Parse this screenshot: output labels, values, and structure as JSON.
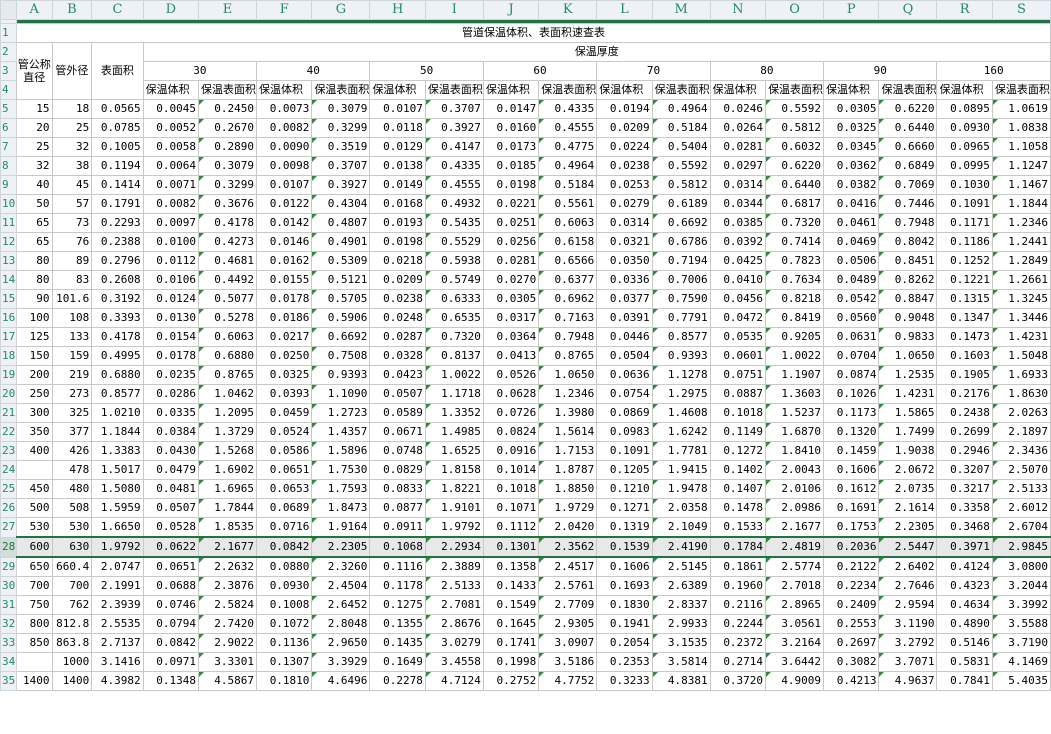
{
  "columns": [
    "A",
    "B",
    "C",
    "D",
    "E",
    "F",
    "G",
    "H",
    "I",
    "J",
    "K",
    "L",
    "M",
    "N",
    "O",
    "P",
    "Q",
    "R",
    "S"
  ],
  "title": "管道保温体积、表面积速查表",
  "headers": {
    "nominal": "管公称直径",
    "outer": "管外径",
    "surface": "表面积",
    "thickness": "保温厚度",
    "thickness_values": [
      "30",
      "40",
      "50",
      "60",
      "70",
      "80",
      "90",
      "160"
    ],
    "vol": "保温体积",
    "surf": "保温表面积"
  },
  "row_numbers": [
    "4",
    "5",
    "6",
    "7",
    "8",
    "9",
    "10",
    "11",
    "12",
    "13",
    "14",
    "15",
    "16",
    "17",
    "18",
    "19",
    "20",
    "21",
    "22",
    "23",
    "24",
    "25",
    "26",
    "27",
    "28",
    "29",
    "30",
    "31",
    "32",
    "33",
    "34",
    "35"
  ],
  "rows": [
    [
      "15",
      "18",
      "0.0565",
      "0.0045",
      "0.2450",
      "0.0073",
      "0.3079",
      "0.0107",
      "0.3707",
      "0.0147",
      "0.4335",
      "0.0194",
      "0.4964",
      "0.0246",
      "0.5592",
      "0.0305",
      "0.6220",
      "0.0895",
      "1.0619"
    ],
    [
      "20",
      "25",
      "0.0785",
      "0.0052",
      "0.2670",
      "0.0082",
      "0.3299",
      "0.0118",
      "0.3927",
      "0.0160",
      "0.4555",
      "0.0209",
      "0.5184",
      "0.0264",
      "0.5812",
      "0.0325",
      "0.6440",
      "0.0930",
      "1.0838"
    ],
    [
      "25",
      "32",
      "0.1005",
      "0.0058",
      "0.2890",
      "0.0090",
      "0.3519",
      "0.0129",
      "0.4147",
      "0.0173",
      "0.4775",
      "0.0224",
      "0.5404",
      "0.0281",
      "0.6032",
      "0.0345",
      "0.6660",
      "0.0965",
      "1.1058"
    ],
    [
      "32",
      "38",
      "0.1194",
      "0.0064",
      "0.3079",
      "0.0098",
      "0.3707",
      "0.0138",
      "0.4335",
      "0.0185",
      "0.4964",
      "0.0238",
      "0.5592",
      "0.0297",
      "0.6220",
      "0.0362",
      "0.6849",
      "0.0995",
      "1.1247"
    ],
    [
      "40",
      "45",
      "0.1414",
      "0.0071",
      "0.3299",
      "0.0107",
      "0.3927",
      "0.0149",
      "0.4555",
      "0.0198",
      "0.5184",
      "0.0253",
      "0.5812",
      "0.0314",
      "0.6440",
      "0.0382",
      "0.7069",
      "0.1030",
      "1.1467"
    ],
    [
      "50",
      "57",
      "0.1791",
      "0.0082",
      "0.3676",
      "0.0122",
      "0.4304",
      "0.0168",
      "0.4932",
      "0.0221",
      "0.5561",
      "0.0279",
      "0.6189",
      "0.0344",
      "0.6817",
      "0.0416",
      "0.7446",
      "0.1091",
      "1.1844"
    ],
    [
      "65",
      "73",
      "0.2293",
      "0.0097",
      "0.4178",
      "0.0142",
      "0.4807",
      "0.0193",
      "0.5435",
      "0.0251",
      "0.6063",
      "0.0314",
      "0.6692",
      "0.0385",
      "0.7320",
      "0.0461",
      "0.7948",
      "0.1171",
      "1.2346"
    ],
    [
      "65",
      "76",
      "0.2388",
      "0.0100",
      "0.4273",
      "0.0146",
      "0.4901",
      "0.0198",
      "0.5529",
      "0.0256",
      "0.6158",
      "0.0321",
      "0.6786",
      "0.0392",
      "0.7414",
      "0.0469",
      "0.8042",
      "0.1186",
      "1.2441"
    ],
    [
      "80",
      "89",
      "0.2796",
      "0.0112",
      "0.4681",
      "0.0162",
      "0.5309",
      "0.0218",
      "0.5938",
      "0.0281",
      "0.6566",
      "0.0350",
      "0.7194",
      "0.0425",
      "0.7823",
      "0.0506",
      "0.8451",
      "0.1252",
      "1.2849"
    ],
    [
      "80",
      "83",
      "0.2608",
      "0.0106",
      "0.4492",
      "0.0155",
      "0.5121",
      "0.0209",
      "0.5749",
      "0.0270",
      "0.6377",
      "0.0336",
      "0.7006",
      "0.0410",
      "0.7634",
      "0.0489",
      "0.8262",
      "0.1221",
      "1.2661"
    ],
    [
      "90",
      "101.6",
      "0.3192",
      "0.0124",
      "0.5077",
      "0.0178",
      "0.5705",
      "0.0238",
      "0.6333",
      "0.0305",
      "0.6962",
      "0.0377",
      "0.7590",
      "0.0456",
      "0.8218",
      "0.0542",
      "0.8847",
      "0.1315",
      "1.3245"
    ],
    [
      "100",
      "108",
      "0.3393",
      "0.0130",
      "0.5278",
      "0.0186",
      "0.5906",
      "0.0248",
      "0.6535",
      "0.0317",
      "0.7163",
      "0.0391",
      "0.7791",
      "0.0472",
      "0.8419",
      "0.0560",
      "0.9048",
      "0.1347",
      "1.3446"
    ],
    [
      "125",
      "133",
      "0.4178",
      "0.0154",
      "0.6063",
      "0.0217",
      "0.6692",
      "0.0287",
      "0.7320",
      "0.0364",
      "0.7948",
      "0.0446",
      "0.8577",
      "0.0535",
      "0.9205",
      "0.0631",
      "0.9833",
      "0.1473",
      "1.4231"
    ],
    [
      "150",
      "159",
      "0.4995",
      "0.0178",
      "0.6880",
      "0.0250",
      "0.7508",
      "0.0328",
      "0.8137",
      "0.0413",
      "0.8765",
      "0.0504",
      "0.9393",
      "0.0601",
      "1.0022",
      "0.0704",
      "1.0650",
      "0.1603",
      "1.5048"
    ],
    [
      "200",
      "219",
      "0.6880",
      "0.0235",
      "0.8765",
      "0.0325",
      "0.9393",
      "0.0423",
      "1.0022",
      "0.0526",
      "1.0650",
      "0.0636",
      "1.1278",
      "0.0751",
      "1.1907",
      "0.0874",
      "1.2535",
      "0.1905",
      "1.6933"
    ],
    [
      "250",
      "273",
      "0.8577",
      "0.0286",
      "1.0462",
      "0.0393",
      "1.1090",
      "0.0507",
      "1.1718",
      "0.0628",
      "1.2346",
      "0.0754",
      "1.2975",
      "0.0887",
      "1.3603",
      "0.1026",
      "1.4231",
      "0.2176",
      "1.8630"
    ],
    [
      "300",
      "325",
      "1.0210",
      "0.0335",
      "1.2095",
      "0.0459",
      "1.2723",
      "0.0589",
      "1.3352",
      "0.0726",
      "1.3980",
      "0.0869",
      "1.4608",
      "0.1018",
      "1.5237",
      "0.1173",
      "1.5865",
      "0.2438",
      "2.0263"
    ],
    [
      "350",
      "377",
      "1.1844",
      "0.0384",
      "1.3729",
      "0.0524",
      "1.4357",
      "0.0671",
      "1.4985",
      "0.0824",
      "1.5614",
      "0.0983",
      "1.6242",
      "0.1149",
      "1.6870",
      "0.1320",
      "1.7499",
      "0.2699",
      "2.1897"
    ],
    [
      "400",
      "426",
      "1.3383",
      "0.0430",
      "1.5268",
      "0.0586",
      "1.5896",
      "0.0748",
      "1.6525",
      "0.0916",
      "1.7153",
      "0.1091",
      "1.7781",
      "0.1272",
      "1.8410",
      "0.1459",
      "1.9038",
      "0.2946",
      "2.3436"
    ],
    [
      "",
      "478",
      "1.5017",
      "0.0479",
      "1.6902",
      "0.0651",
      "1.7530",
      "0.0829",
      "1.8158",
      "0.1014",
      "1.8787",
      "0.1205",
      "1.9415",
      "0.1402",
      "2.0043",
      "0.1606",
      "2.0672",
      "0.3207",
      "2.5070"
    ],
    [
      "450",
      "480",
      "1.5080",
      "0.0481",
      "1.6965",
      "0.0653",
      "1.7593",
      "0.0833",
      "1.8221",
      "0.1018",
      "1.8850",
      "0.1210",
      "1.9478",
      "0.1407",
      "2.0106",
      "0.1612",
      "2.0735",
      "0.3217",
      "2.5133"
    ],
    [
      "500",
      "508",
      "1.5959",
      "0.0507",
      "1.7844",
      "0.0689",
      "1.8473",
      "0.0877",
      "1.9101",
      "0.1071",
      "1.9729",
      "0.1271",
      "2.0358",
      "0.1478",
      "2.0986",
      "0.1691",
      "2.1614",
      "0.3358",
      "2.6012"
    ],
    [
      "530",
      "530",
      "1.6650",
      "0.0528",
      "1.8535",
      "0.0716",
      "1.9164",
      "0.0911",
      "1.9792",
      "0.1112",
      "2.0420",
      "0.1319",
      "2.1049",
      "0.1533",
      "2.1677",
      "0.1753",
      "2.2305",
      "0.3468",
      "2.6704"
    ],
    [
      "600",
      "630",
      "1.9792",
      "0.0622",
      "2.1677",
      "0.0842",
      "2.2305",
      "0.1068",
      "2.2934",
      "0.1301",
      "2.3562",
      "0.1539",
      "2.4190",
      "0.1784",
      "2.4819",
      "0.2036",
      "2.5447",
      "0.3971",
      "2.9845"
    ],
    [
      "650",
      "660.4",
      "2.0747",
      "0.0651",
      "2.2632",
      "0.0880",
      "2.3260",
      "0.1116",
      "2.3889",
      "0.1358",
      "2.4517",
      "0.1606",
      "2.5145",
      "0.1861",
      "2.5774",
      "0.2122",
      "2.6402",
      "0.4124",
      "3.0800"
    ],
    [
      "700",
      "700",
      "2.1991",
      "0.0688",
      "2.3876",
      "0.0930",
      "2.4504",
      "0.1178",
      "2.5133",
      "0.1433",
      "2.5761",
      "0.1693",
      "2.6389",
      "0.1960",
      "2.7018",
      "0.2234",
      "2.7646",
      "0.4323",
      "3.2044"
    ],
    [
      "750",
      "762",
      "2.3939",
      "0.0746",
      "2.5824",
      "0.1008",
      "2.6452",
      "0.1275",
      "2.7081",
      "0.1549",
      "2.7709",
      "0.1830",
      "2.8337",
      "0.2116",
      "2.8965",
      "0.2409",
      "2.9594",
      "0.4634",
      "3.3992"
    ],
    [
      "800",
      "812.8",
      "2.5535",
      "0.0794",
      "2.7420",
      "0.1072",
      "2.8048",
      "0.1355",
      "2.8676",
      "0.1645",
      "2.9305",
      "0.1941",
      "2.9933",
      "0.2244",
      "3.0561",
      "0.2553",
      "3.1190",
      "0.4890",
      "3.5588"
    ],
    [
      "850",
      "863.8",
      "2.7137",
      "0.0842",
      "2.9022",
      "0.1136",
      "2.9650",
      "0.1435",
      "3.0279",
      "0.1741",
      "3.0907",
      "0.2054",
      "3.1535",
      "0.2372",
      "3.2164",
      "0.2697",
      "3.2792",
      "0.5146",
      "3.7190"
    ],
    [
      "",
      "1000",
      "3.1416",
      "0.0971",
      "3.3301",
      "0.1307",
      "3.3929",
      "0.1649",
      "3.4558",
      "0.1998",
      "3.5186",
      "0.2353",
      "3.5814",
      "0.2714",
      "3.6442",
      "0.3082",
      "3.7071",
      "0.5831",
      "4.1469"
    ],
    [
      "1400",
      "1400",
      "4.3982",
      "0.1348",
      "4.5867",
      "0.1810",
      "4.6496",
      "0.2278",
      "4.7124",
      "0.2752",
      "4.7752",
      "0.3233",
      "4.8381",
      "0.3720",
      "4.9009",
      "0.4213",
      "4.9637",
      "0.7841",
      "5.4035"
    ]
  ],
  "selected_row_index": 23,
  "accent_color": "#217346"
}
